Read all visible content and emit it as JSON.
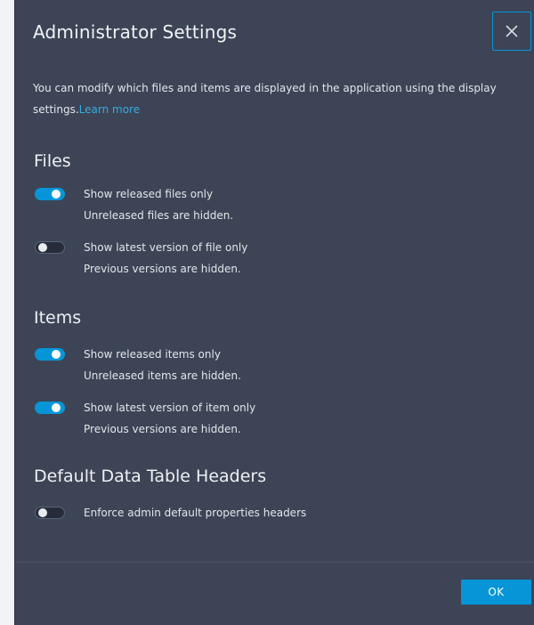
{
  "dialog": {
    "title": "Administrator Settings",
    "close_icon": "close-icon",
    "intro_text": "You can modify which files and items are displayed in the application using the display settings.",
    "learn_more": "Learn more",
    "ok_label": "OK",
    "colors": {
      "background": "#3c4456",
      "accent": "#0696d7",
      "link": "#38abdf"
    }
  },
  "sections": {
    "files": {
      "title": "Files",
      "toggles": [
        {
          "label": "Show released files only",
          "description": "Unreleased files are hidden.",
          "on": true
        },
        {
          "label": "Show latest version of file only",
          "description": "Previous versions are hidden.",
          "on": false
        }
      ]
    },
    "items": {
      "title": "Items",
      "toggles": [
        {
          "label": "Show released items only",
          "description": "Unreleased items are hidden.",
          "on": true
        },
        {
          "label": "Show latest version of item only",
          "description": "Previous versions are hidden.",
          "on": true
        }
      ]
    },
    "headers": {
      "title": "Default Data Table Headers",
      "toggles": [
        {
          "label": "Enforce admin default properties headers",
          "on": false
        }
      ]
    }
  }
}
